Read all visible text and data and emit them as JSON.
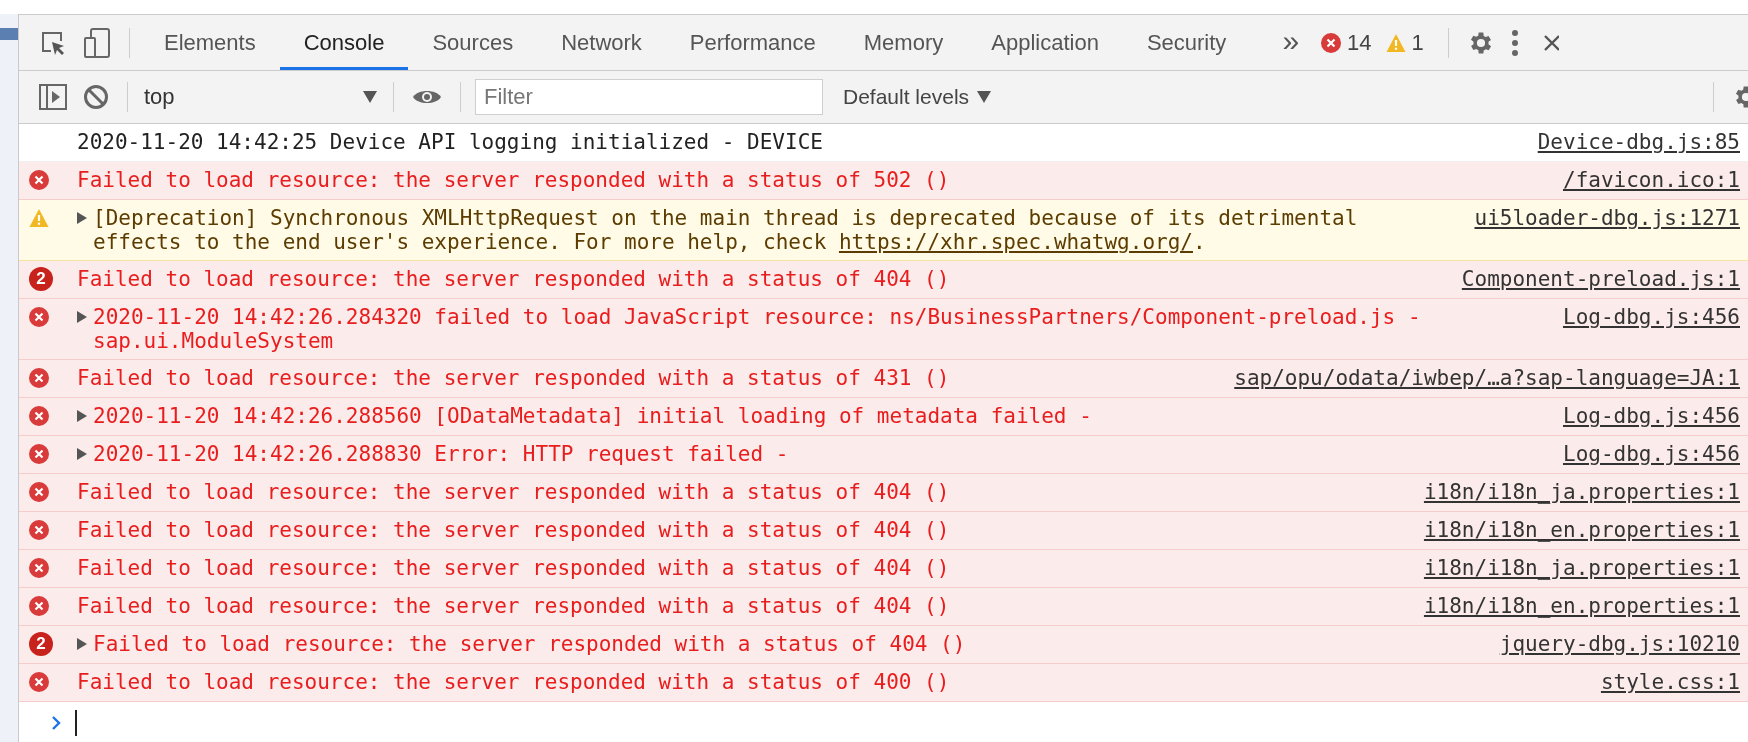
{
  "tabs": [
    {
      "label": "Elements",
      "selected": false
    },
    {
      "label": "Console",
      "selected": true
    },
    {
      "label": "Sources",
      "selected": false
    },
    {
      "label": "Network",
      "selected": false
    },
    {
      "label": "Performance",
      "selected": false
    },
    {
      "label": "Memory",
      "selected": false
    },
    {
      "label": "Application",
      "selected": false
    },
    {
      "label": "Security",
      "selected": false
    }
  ],
  "more_tabs": "»",
  "counts": {
    "errors": "14",
    "warnings": "1"
  },
  "context": {
    "value": "top"
  },
  "filter": {
    "placeholder": "Filter"
  },
  "levels": {
    "label": "Default levels"
  },
  "messages": [
    {
      "kind": "log",
      "text": "2020-11-20 14:42:25 Device API logging initialized - DEVICE",
      "source": "Device-dbg.js:85"
    },
    {
      "kind": "error",
      "text": "Failed to load resource: the server responded with a status of 502 ()",
      "source": "/favicon.ico:1"
    },
    {
      "kind": "warning",
      "expandable": true,
      "text": "[Deprecation] Synchronous XMLHttpRequest on the main thread is deprecated because of its detrimental\neffects to the end user's experience. For more help, check ",
      "link": "https://xhr.spec.whatwg.org/",
      "text_after": ".",
      "source": "ui5loader-dbg.js:1271"
    },
    {
      "kind": "error",
      "count": "2",
      "text": "Failed to load resource: the server responded with a status of 404 ()",
      "source": "Component-preload.js:1"
    },
    {
      "kind": "error",
      "expandable": true,
      "text": "2020-11-20 14:42:26.284320 failed to load JavaScript resource: ns/BusinessPartners/Component-preload.js -\nsap.ui.ModuleSystem",
      "source": "Log-dbg.js:456"
    },
    {
      "kind": "error",
      "text": "Failed to load resource: the server responded with a status of 431 ()",
      "source": "sap/opu/odata/iwbep/…a?sap-language=JA:1"
    },
    {
      "kind": "error",
      "expandable": true,
      "text": "2020-11-20 14:42:26.288560 [ODataMetadata] initial loading of metadata failed -",
      "source": "Log-dbg.js:456"
    },
    {
      "kind": "error",
      "expandable": true,
      "text": "2020-11-20 14:42:26.288830 Error: HTTP request failed -",
      "source": "Log-dbg.js:456"
    },
    {
      "kind": "error",
      "text": "Failed to load resource: the server responded with a status of 404 ()",
      "source": "i18n/i18n_ja.properties:1"
    },
    {
      "kind": "error",
      "text": "Failed to load resource: the server responded with a status of 404 ()",
      "source": "i18n/i18n_en.properties:1"
    },
    {
      "kind": "error",
      "text": "Failed to load resource: the server responded with a status of 404 ()",
      "source": "i18n/i18n_ja.properties:1"
    },
    {
      "kind": "error",
      "text": "Failed to load resource: the server responded with a status of 404 ()",
      "source": "i18n/i18n_en.properties:1"
    },
    {
      "kind": "error",
      "count": "2",
      "expandable": true,
      "text": "Failed to load resource: the server responded with a status of 404 ()",
      "source": "jquery-dbg.js:10210"
    },
    {
      "kind": "error",
      "text": "Failed to load resource: the server responded with a status of 400 ()",
      "source": "style.css:1"
    }
  ]
}
